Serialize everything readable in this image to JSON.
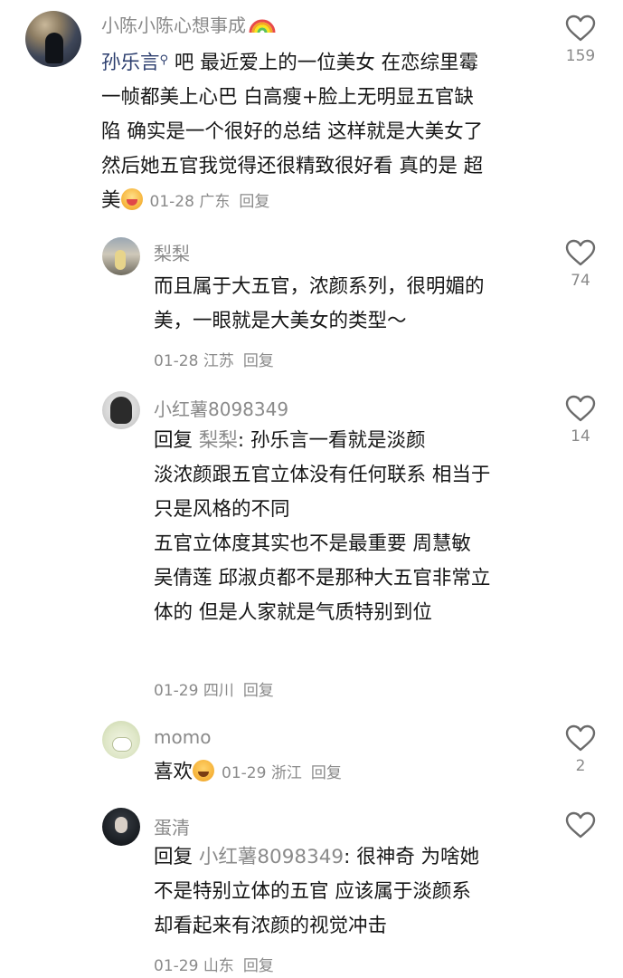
{
  "comments": [
    {
      "username": "小陈小陈心想事成",
      "badge_icon": "rainbow-icon",
      "mention": "孙乐言",
      "lines": [
        "吧 最近爱上的一位美女 在恋综里霉",
        "一帧都美上心巴 白高瘦+脸上无明显五官缺",
        "陷 确实是一个很好的总结 这样就是大美女了",
        "然后她五官我觉得还很精致很好看 真的是 超",
        "美"
      ],
      "date": "01-28",
      "location": "广东",
      "reply_label": "回复",
      "likes": "159"
    },
    {
      "username": "梨梨",
      "lines": [
        "而且属于大五官，浓颜系列，很明媚的",
        "美，一眼就是大美女的类型～"
      ],
      "date": "01-28",
      "location": "江苏",
      "reply_label": "回复",
      "likes": "74"
    },
    {
      "username": "小红薯8098349",
      "reply_prefix": "回复",
      "reply_to": "梨梨",
      "first_line_rest": ": 孙乐言一看就是淡颜",
      "lines": [
        "淡浓颜跟五官立体没有任何联系 相当于",
        "只是风格的不同",
        "五官立体度其实也不是最重要 周慧敏",
        "吴倩莲 邱淑贞都不是那种大五官非常立",
        "体的 但是人家就是气质特别到位"
      ],
      "date": "01-29",
      "location": "四川",
      "reply_label": "回复",
      "likes": "14"
    },
    {
      "username": "momo",
      "text": "喜欢",
      "date": "01-29",
      "location": "浙江",
      "reply_label": "回复",
      "likes": "2"
    },
    {
      "username": "蛋清",
      "reply_prefix": "回复",
      "reply_to": "小红薯8098349",
      "first_line_rest": ": 很神奇 为啥她",
      "lines": [
        "不是特别立体的五官 应该属于淡颜系",
        "却看起来有浓颜的视觉冲击"
      ],
      "date": "01-29",
      "location": "山东",
      "reply_label": "回复",
      "likes": ""
    }
  ],
  "colors": {
    "text": "#161616",
    "muted": "#8a8a8a",
    "mention": "#2c3e6e",
    "heart_stroke": "#6b6b6b"
  }
}
